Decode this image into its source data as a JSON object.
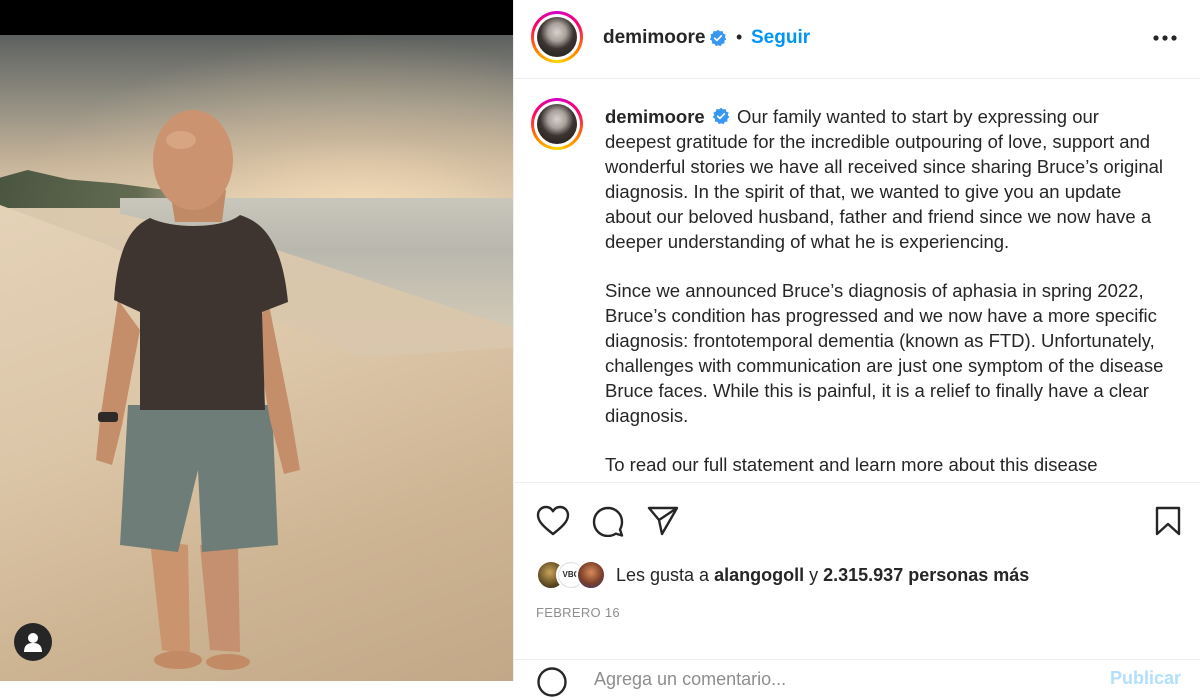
{
  "media": {
    "icons": {
      "user_tag": "user-icon"
    }
  },
  "header": {
    "username": "demimoore",
    "separator": "•",
    "follow_label": "Seguir",
    "icons": {
      "verified": "verified-badge-icon",
      "more": "more-horizontal-icon"
    }
  },
  "caption": {
    "username": "demimoore",
    "paragraphs": [
      "Our family wanted to start by expressing our deepest gratitude for the incredible outpouring of love, support and wonderful stories we have all received since sharing Bruce’s original diagnosis. In the spirit of that, we wanted to give you an update about our beloved husband, father and friend since we now have a deeper understanding of what he is experiencing.",
      "Since we announced Bruce’s diagnosis of aphasia in spring 2022, Bruce’s condition has progressed and we now have a more specific diagnosis: frontotemporal dementia (known as FTD). Unfortunately, challenges with communication are just one symptom of the disease Bruce faces. While this is painful, it is a relief to finally have a clear diagnosis.",
      "To read our full statement and learn more about this disease"
    ]
  },
  "actions": {
    "icons": [
      "heart-icon",
      "comment-icon",
      "share-icon",
      "bookmark-icon"
    ]
  },
  "likes": {
    "prefix": "Les gusta a",
    "user": "alangogoll",
    "connector": "y",
    "count_text": "2.315.937 personas más",
    "avatar_badge": "VBC"
  },
  "date": "FEBRERO 16",
  "comment": {
    "placeholder": "Agrega un comentario...",
    "publish_label": "Publicar",
    "icons": {
      "emoji": "emoji-icon"
    }
  },
  "colors": {
    "link_blue": "#0095f6",
    "publish_disabled": "#b2dffc",
    "verified_blue": "#3897f0",
    "text": "#262626",
    "muted": "#8e8e8e"
  }
}
